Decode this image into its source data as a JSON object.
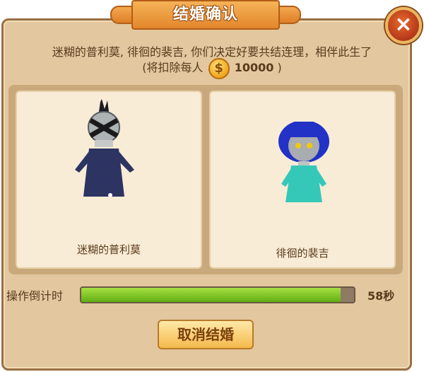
{
  "dialog": {
    "title": "结婚确认",
    "close_symbol": "×",
    "message": "迷糊的普利莫, 徘徊的裴吉, 你们决定好要共结连理，相伴此生了",
    "cost_prefix": "(将扣除每人",
    "coin_symbol": "$",
    "cost_amount": "10000",
    "cost_suffix": ")"
  },
  "cards": [
    {
      "name": "迷糊的普利莫"
    },
    {
      "name": "徘徊的裴吉"
    }
  ],
  "countdown": {
    "label": "操作倒计时",
    "value": "58秒",
    "progress": 0.95
  },
  "buttons": {
    "cancel": "取消结婚"
  },
  "icons": {
    "close": "close-icon",
    "coin": "gold-coin-icon"
  },
  "colors": {
    "panel": "#e2c79f",
    "title": "#e3862b",
    "progress": "#7cc52a",
    "close": "#c4441f"
  }
}
